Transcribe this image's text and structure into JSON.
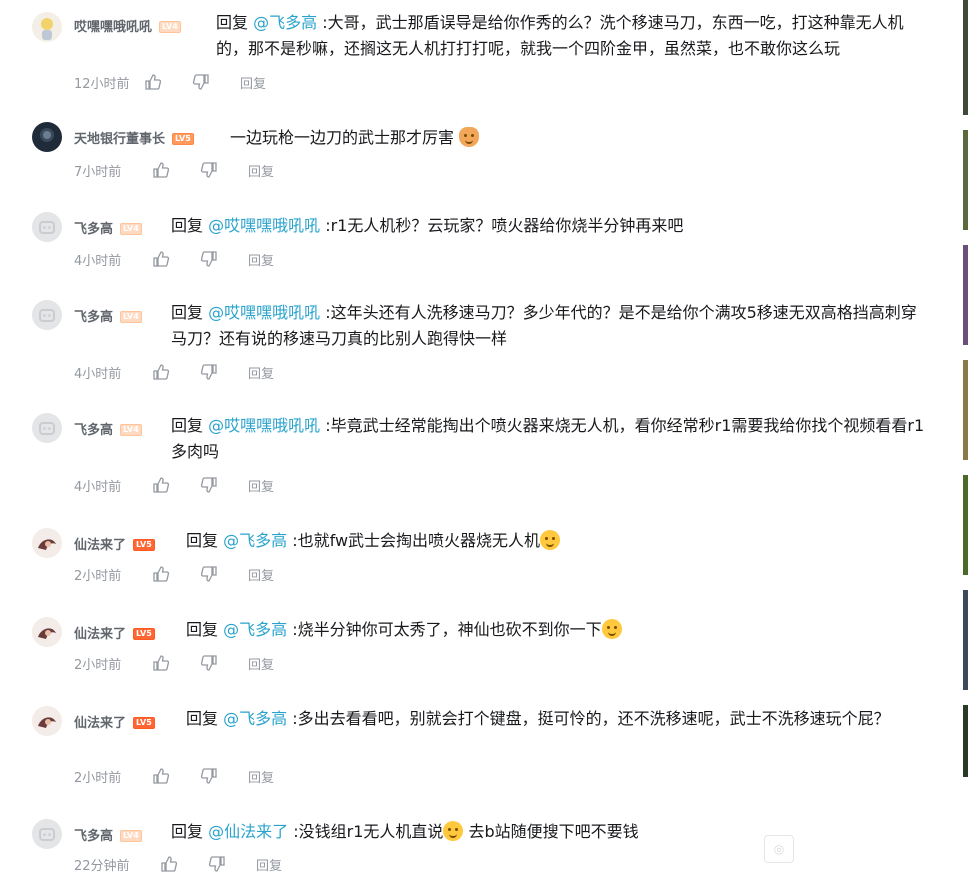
{
  "comments": [
    {
      "user": "哎嘿嘿哦吼吼",
      "level": "LV4",
      "prefix": "回复",
      "mention": "@飞多高",
      "text": ":大哥，武士那盾误导是给你作秀的么？洗个移速马刀，东西一吃，打这种靠无人机的，那不是秒嘛，还搁这无人机打打打呢，就我一个四阶金甲，虽然菜，也不敢你这么玩",
      "time": "12小时前",
      "reply_label": "回复"
    },
    {
      "user": "天地银行董事长",
      "level": "LV5",
      "prefix": "",
      "mention": "",
      "text": "一边玩枪一边刀的武士那才厉害",
      "time": "7小时前",
      "reply_label": "回复"
    },
    {
      "user": "飞多高",
      "level": "LV4",
      "prefix": "回复",
      "mention": "@哎嘿嘿哦吼吼",
      "text": ":r1无人机秒？云玩家？喷火器给你烧半分钟再来吧",
      "time": "4小时前",
      "reply_label": "回复"
    },
    {
      "user": "飞多高",
      "level": "LV4",
      "prefix": "回复",
      "mention": "@哎嘿嘿哦吼吼",
      "text": ":这年头还有人洗移速马刀？多少年代的？是不是给你个满攻5移速无双高格挡高刺穿马刀？还有说的移速马刀真的比别人跑得快一样",
      "time": "4小时前",
      "reply_label": "回复"
    },
    {
      "user": "飞多高",
      "level": "LV4",
      "prefix": "回复",
      "mention": "@哎嘿嘿哦吼吼",
      "text": ":毕竟武士经常能掏出个喷火器来烧无人机，看你经常秒r1需要我给你找个视频看看r1多肉吗",
      "time": "4小时前",
      "reply_label": "回复"
    },
    {
      "user": "仙法来了",
      "level": "LV5",
      "prefix": "回复",
      "mention": "@飞多高",
      "text": ":也就fw武士会掏出喷火器烧无人机",
      "time": "2小时前",
      "reply_label": "回复"
    },
    {
      "user": "仙法来了",
      "level": "LV5",
      "prefix": "回复",
      "mention": "@飞多高",
      "text": ":烧半分钟你可太秀了，神仙也砍不到你一下",
      "time": "2小时前",
      "reply_label": "回复"
    },
    {
      "user": "仙法来了",
      "level": "LV5",
      "prefix": "回复",
      "mention": "@飞多高",
      "text": ":多出去看看吧，别就会打个键盘，挺可怜的，还不洗移速呢，武士不洗移速玩个屁？",
      "time": "2小时前",
      "reply_label": "回复"
    },
    {
      "user": "飞多高",
      "level": "LV4",
      "prefix": "回复",
      "mention": "@仙法来了",
      "text": ":没钱组r1无人机直说",
      "text2": "去b站随便搜下吧不要钱",
      "time": "22分钟前",
      "reply_label": "回复"
    }
  ],
  "colors": {
    "mention": "#2aa3cc",
    "meta": "#9499a0",
    "username": "#61666d"
  }
}
